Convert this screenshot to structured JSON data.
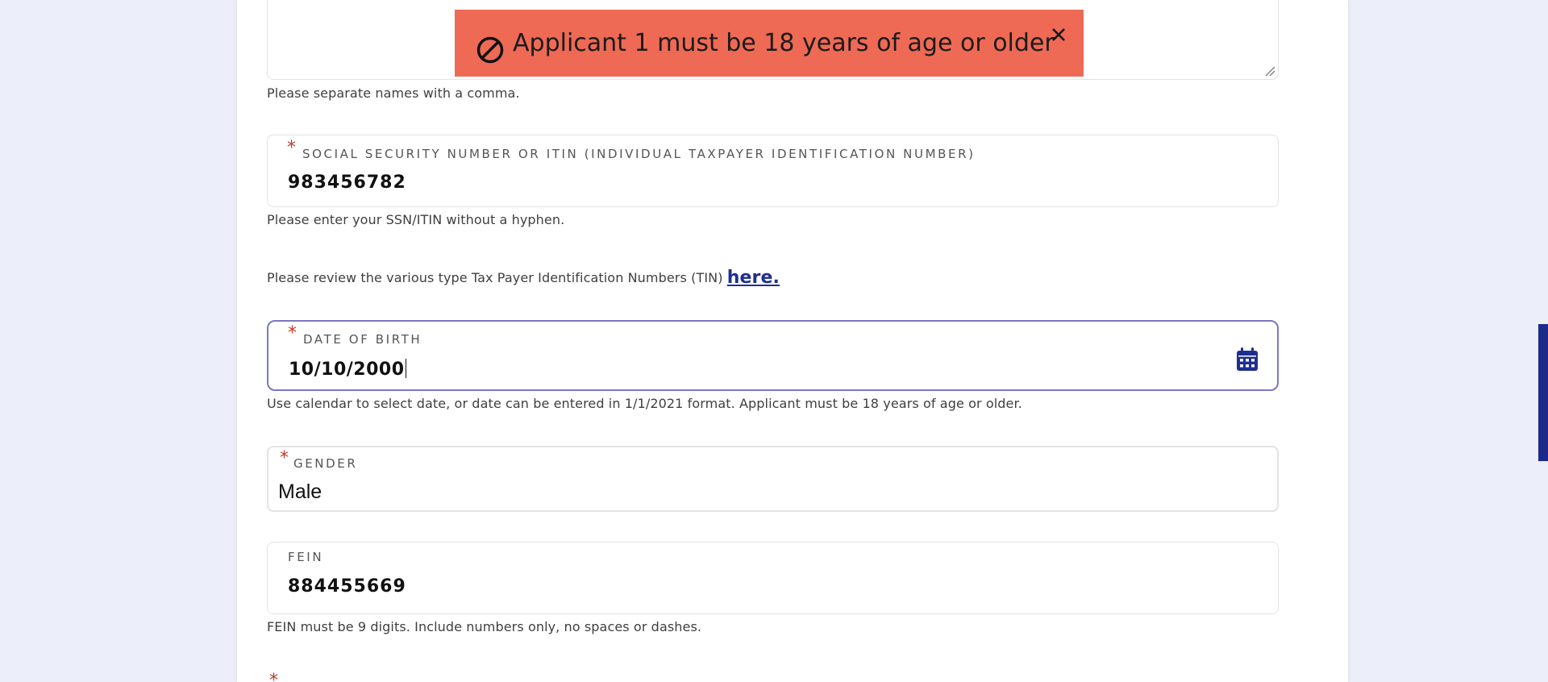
{
  "toast": {
    "message": "Applicant 1 must be 18 years of age or older",
    "icon": "ban-icon",
    "close_icon": "close-icon",
    "background_color": "#ee6a55"
  },
  "names_field": {
    "helper": "Please separate names with a comma."
  },
  "ssn_field": {
    "required_mark": "*",
    "label": "SOCIAL SECURITY NUMBER OR ITIN (INDIVIDUAL TAXPAYER IDENTIFICATION NUMBER)",
    "value": "983456782",
    "helper": "Please enter your SSN/ITIN without a hyphen."
  },
  "tin_notice": {
    "text": "Please review the various type Tax Payer Identification Numbers (TIN) ",
    "link_label": "here."
  },
  "dob_field": {
    "required_mark": "*",
    "label": "DATE OF BIRTH",
    "value": "10/10/2000",
    "icon": "calendar-icon",
    "helper": "Use calendar to select date, or date can be entered in 1/1/2021 format. Applicant must be 18 years of age or older."
  },
  "gender_field": {
    "required_mark": "*",
    "label": "GENDER",
    "value": "Male"
  },
  "fein_field": {
    "label": "FEIN",
    "value": "884455669",
    "helper": "FEIN must be 9 digits. Include numbers only, no spaces or dashes."
  },
  "next_question": {
    "required_mark": "*"
  },
  "colors": {
    "page_background": "#eceef9",
    "accent": "#1f2f8f",
    "required": "#c0392b",
    "focus_border": "#7a78c2"
  }
}
